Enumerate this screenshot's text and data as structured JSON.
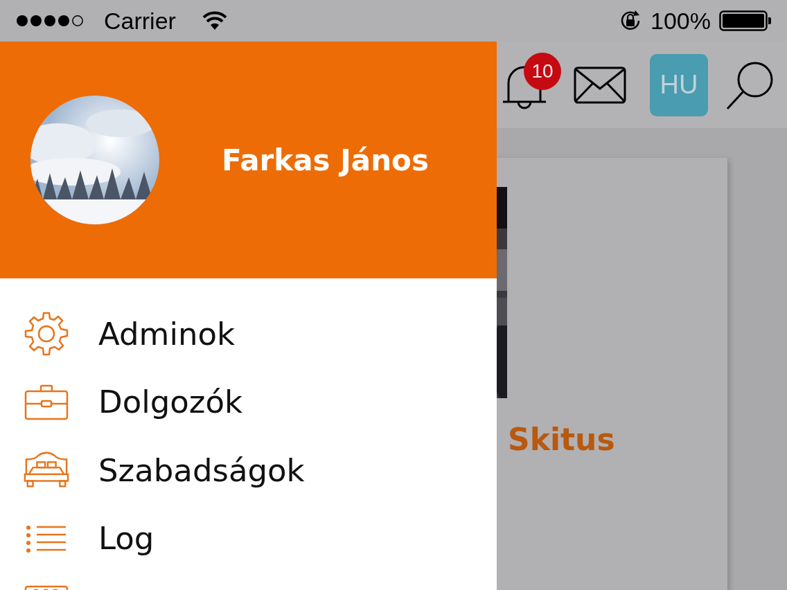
{
  "status_bar": {
    "carrier": "Carrier",
    "battery": "100%"
  },
  "header": {
    "notifications_badge": "10",
    "language": "HU"
  },
  "drawer": {
    "user_name": "Farkas János",
    "menu": [
      {
        "kind": "gear",
        "label": "Adminok"
      },
      {
        "kind": "briefcase",
        "label": "Dolgozók"
      },
      {
        "kind": "bed",
        "label": "Szabadságok"
      },
      {
        "kind": "list",
        "label": "Log"
      },
      {
        "kind": "calendar"
      }
    ]
  },
  "card": {
    "title": "Skitus"
  }
}
